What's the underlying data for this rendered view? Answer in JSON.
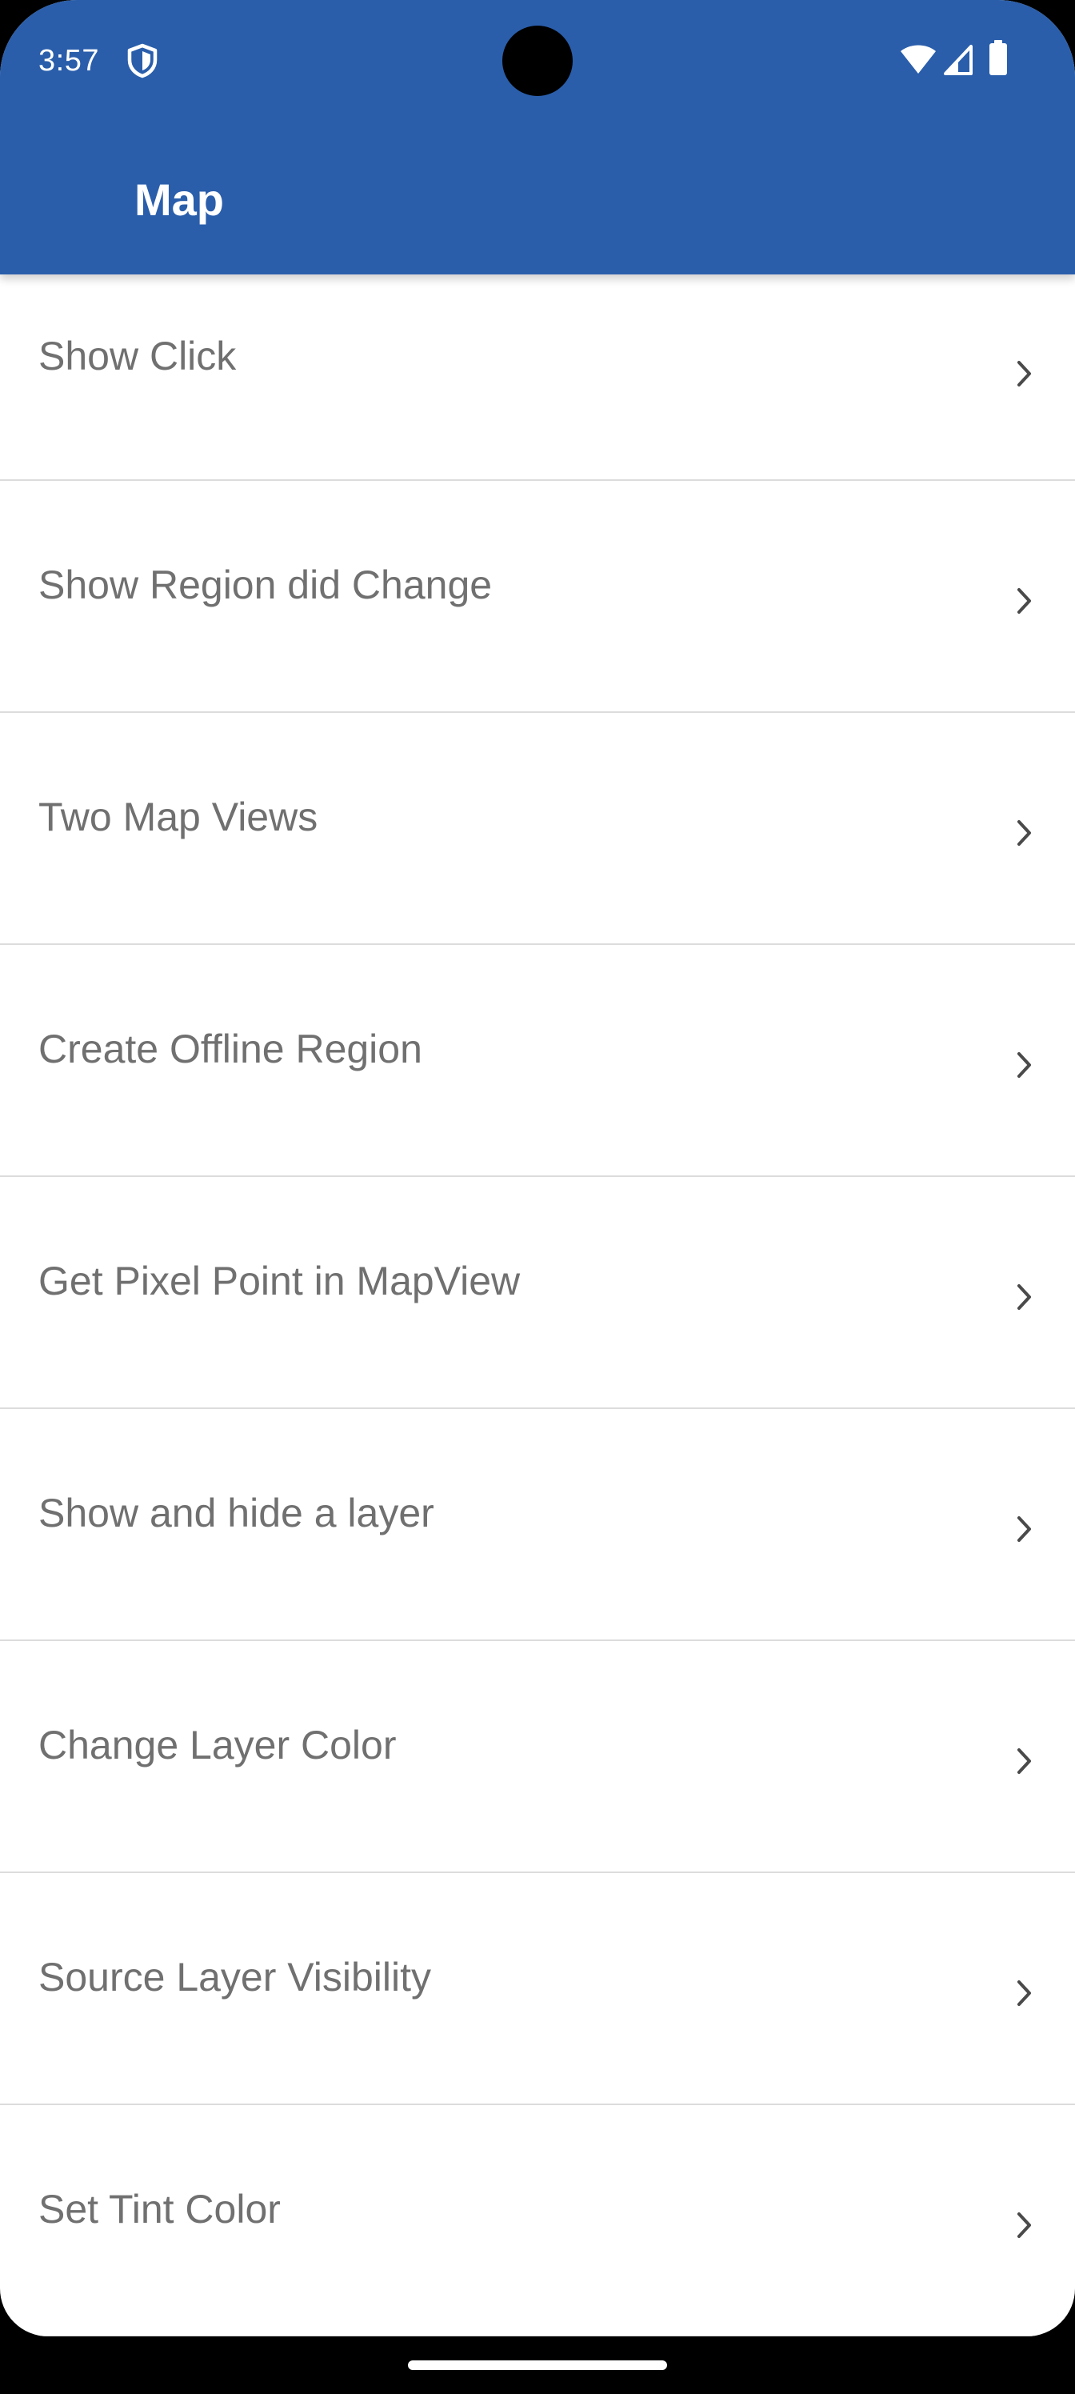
{
  "status_bar": {
    "time": "3:57",
    "icons": [
      "shield-icon",
      "wifi-icon",
      "cell-signal-icon",
      "battery-icon"
    ]
  },
  "app_bar": {
    "title": "Map",
    "background_color": "#2a5eab"
  },
  "list": {
    "items": [
      {
        "label": "Show Click",
        "icon": "chevron-right-icon"
      },
      {
        "label": "Show Region did Change",
        "icon": "chevron-right-icon"
      },
      {
        "label": "Two Map Views",
        "icon": "chevron-right-icon"
      },
      {
        "label": "Create Offline Region",
        "icon": "chevron-right-icon"
      },
      {
        "label": "Get Pixel Point in MapView",
        "icon": "chevron-right-icon"
      },
      {
        "label": "Show and hide a layer",
        "icon": "chevron-right-icon"
      },
      {
        "label": "Change Layer Color",
        "icon": "chevron-right-icon"
      },
      {
        "label": "Source Layer Visibility",
        "icon": "chevron-right-icon"
      },
      {
        "label": "Set Tint Color",
        "icon": "chevron-right-icon"
      }
    ]
  },
  "colors": {
    "accent": "#2a5eab",
    "item_text": "#707070",
    "divider": "#dcdcdc"
  }
}
